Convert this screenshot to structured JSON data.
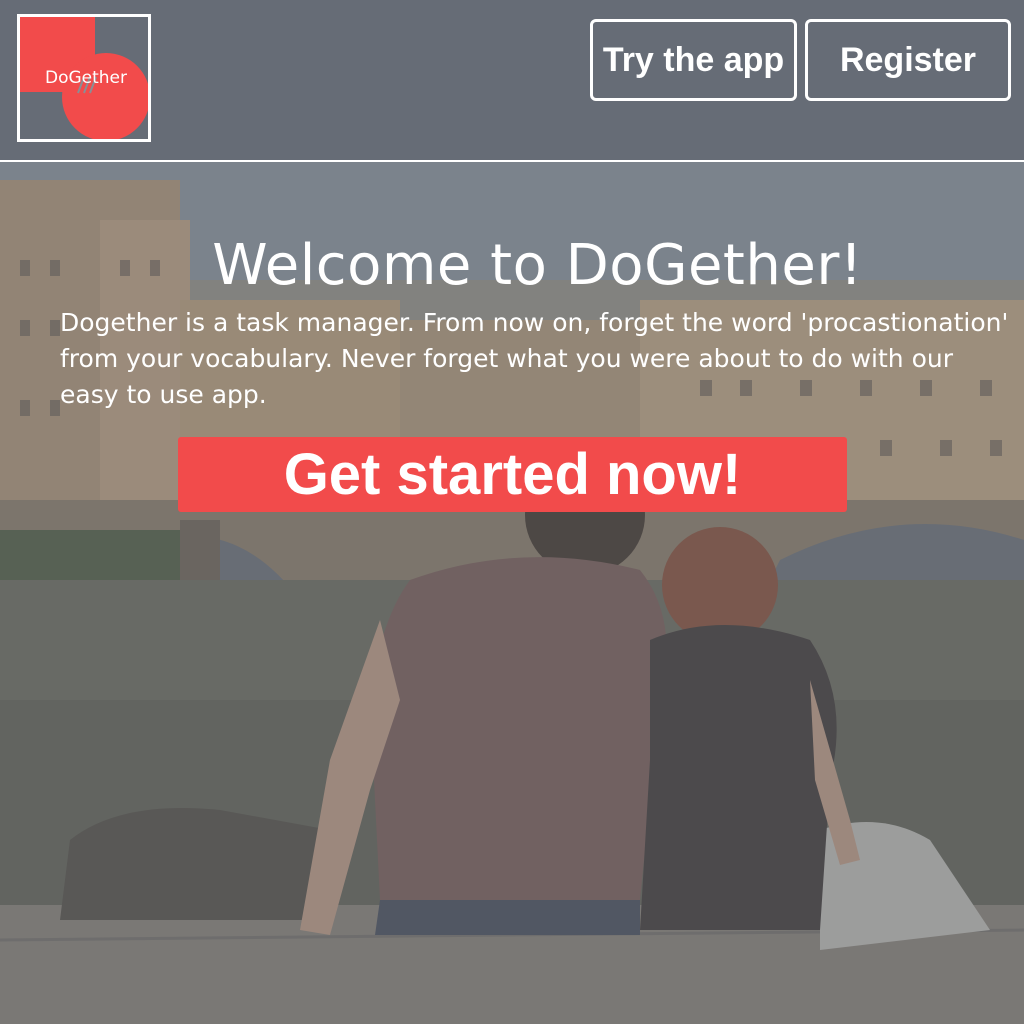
{
  "header": {
    "logo_text": "DoGether",
    "try_app_label": "Try the app",
    "register_label": "Register"
  },
  "hero": {
    "title": "Welcome to DoGether!",
    "description": "Dogether is a task manager. From now on, forget the word 'procastionation' from your vocabulary. Never forget what you were about to do with our easy to use app.",
    "cta_label": "Get started now!"
  },
  "colors": {
    "accent": "#f24b4b",
    "header_bg": "#666c76",
    "text": "#ffffff"
  },
  "background_image": "couple sitting on river wall facing bridge and buildings"
}
